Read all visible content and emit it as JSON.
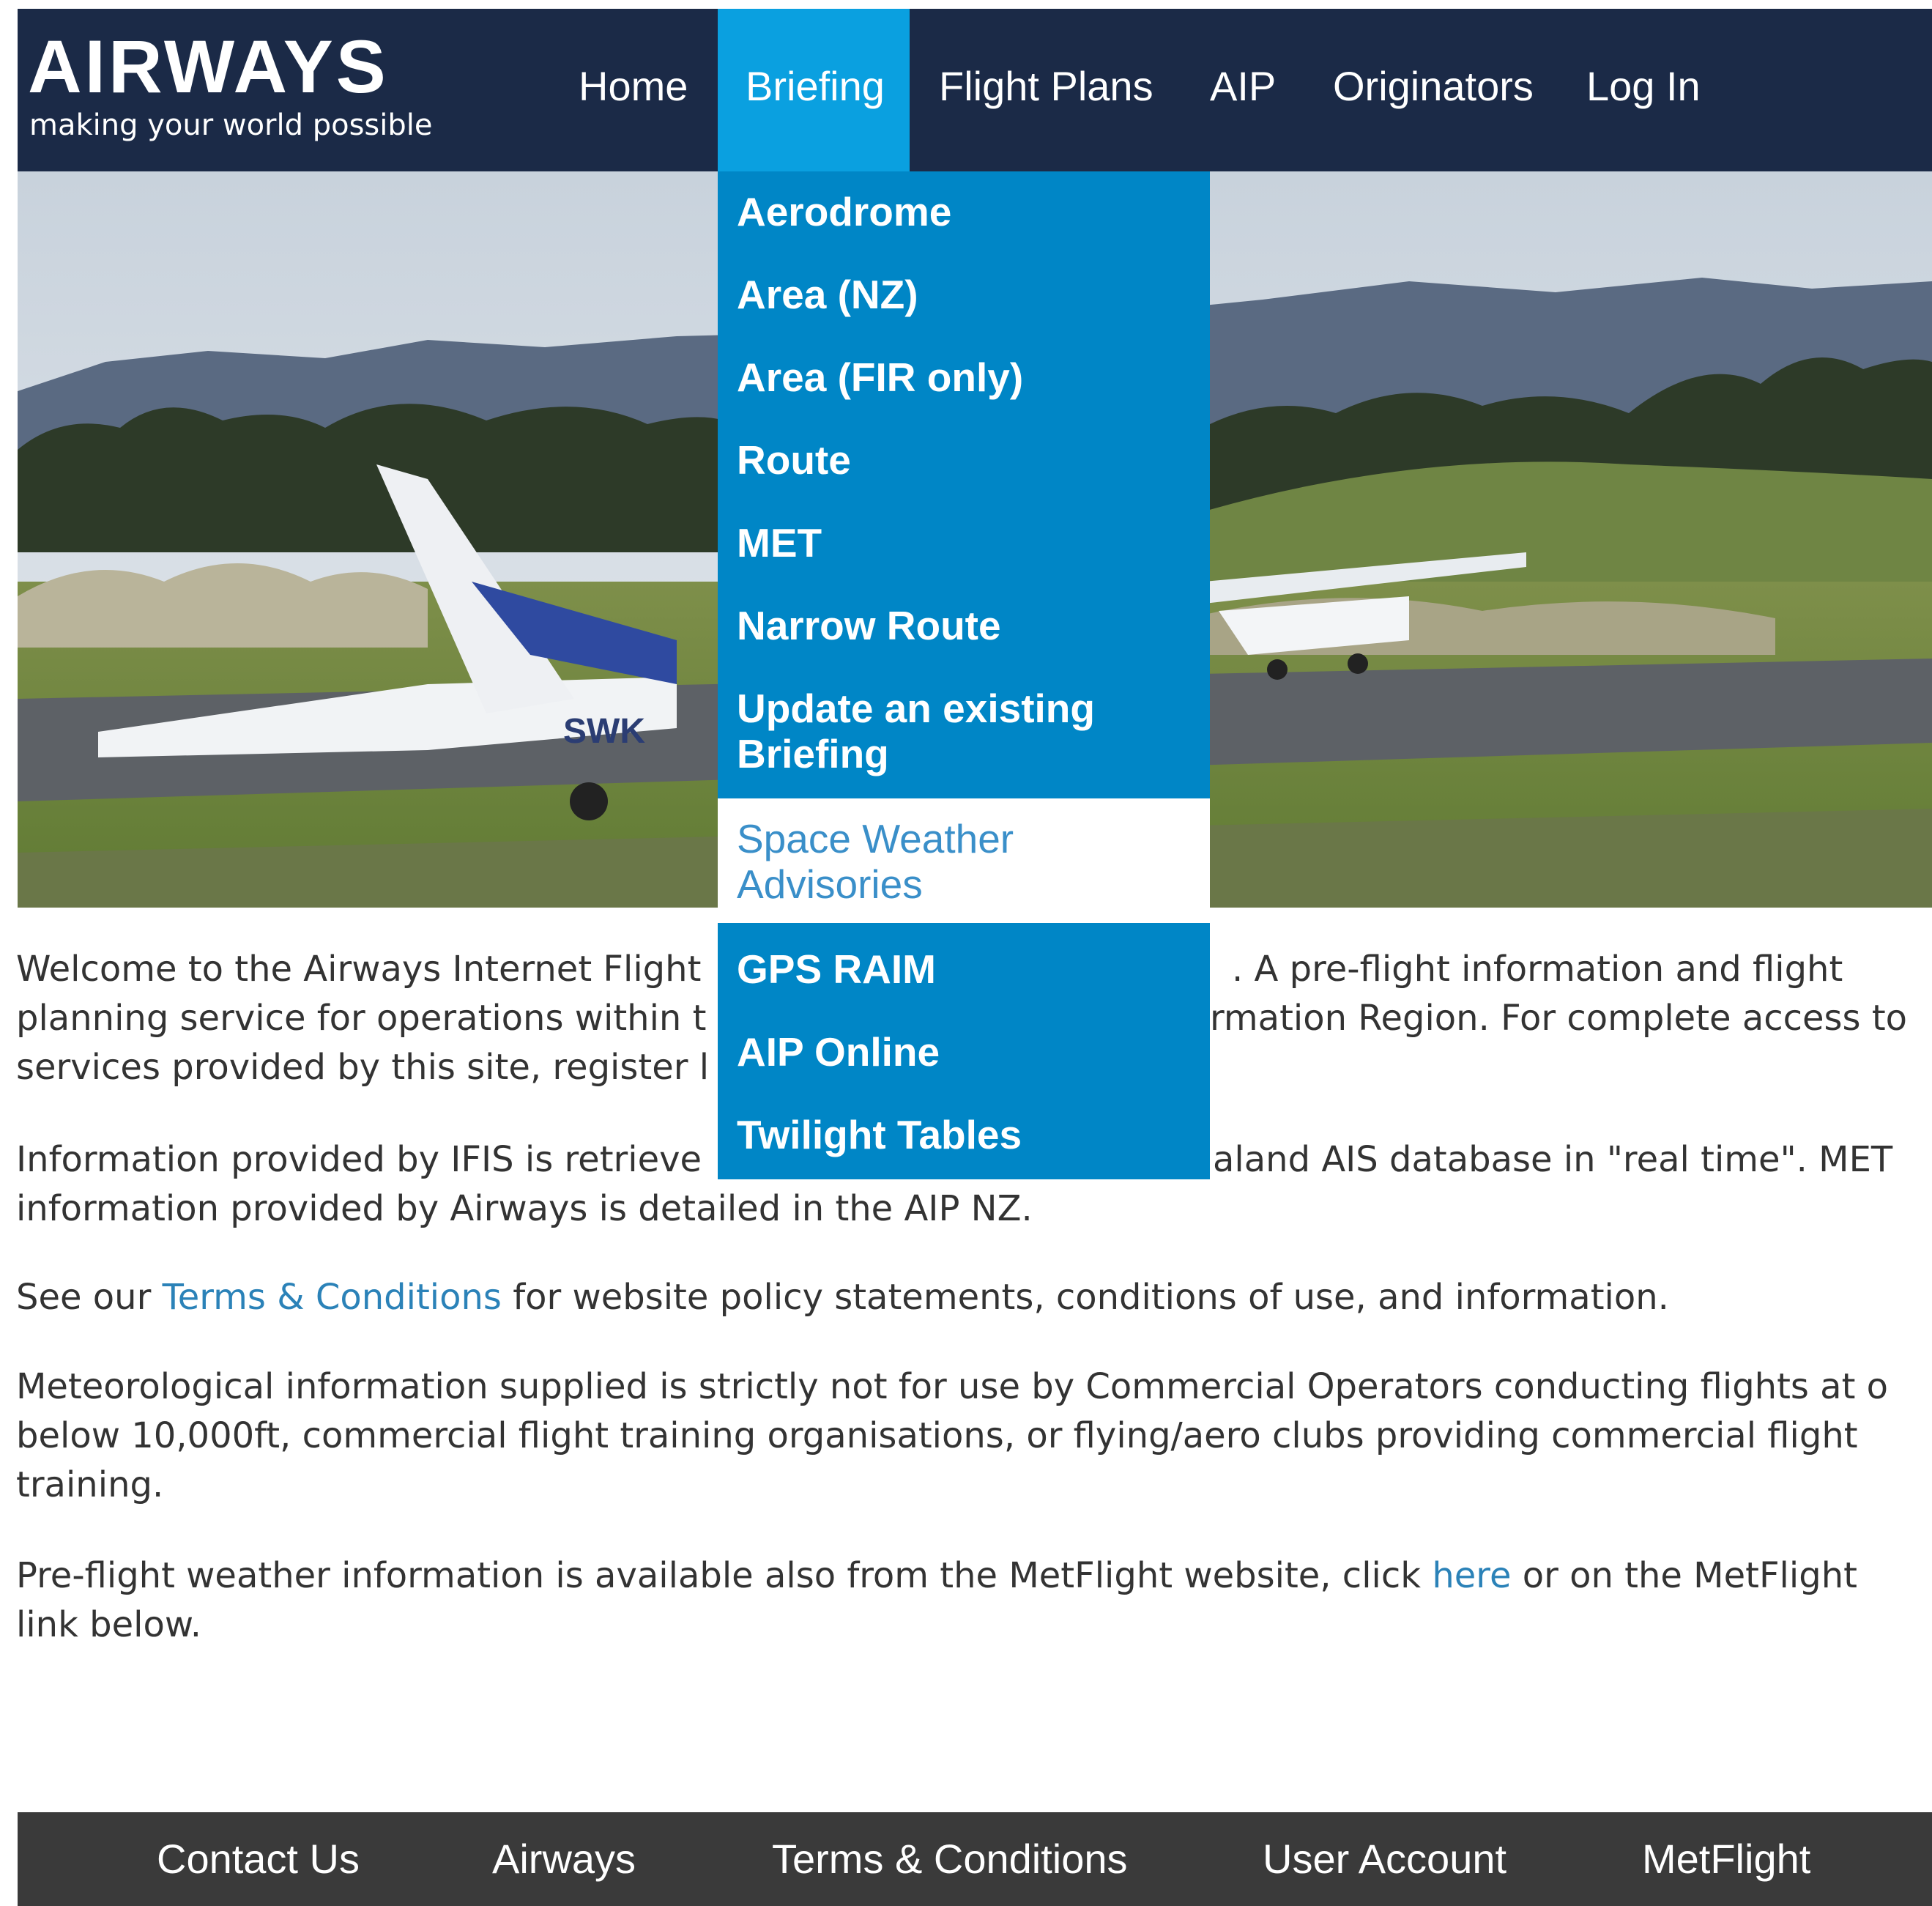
{
  "brand": {
    "wordmark": "AIRWAYS",
    "tagline": "making your world possible"
  },
  "nav": {
    "items": [
      {
        "label": "Home"
      },
      {
        "label": "Briefing",
        "active": true
      },
      {
        "label": "Flight Plans"
      },
      {
        "label": "AIP"
      },
      {
        "label": "Originators"
      },
      {
        "label": "Log In"
      }
    ]
  },
  "hero": {
    "aircraft_registration": "SWK"
  },
  "dropdown": {
    "items": [
      {
        "line1": "Aerodrome"
      },
      {
        "line1": "Area (NZ)"
      },
      {
        "line1": "Area (FIR only)"
      },
      {
        "line1": "Route"
      },
      {
        "line1": "MET"
      },
      {
        "line1": "Narrow Route"
      },
      {
        "line1": "Update an existing",
        "line2": "Briefing"
      },
      {
        "line1": "Space Weather",
        "line2": "Advisories",
        "hovered": true
      },
      {
        "line1": "GPS RAIM"
      },
      {
        "line1": "AIP Online"
      },
      {
        "line1": "Twilight Tables"
      }
    ]
  },
  "content": {
    "p1": {
      "l1a": "Welcome to the Airways Internet Flight",
      "l1b": ". A pre-flight information and flight",
      "l2a": "planning service for operations within t",
      "l2b": "rmation Region. For complete access to",
      "l3a": "services provided by this site, register l"
    },
    "p2": {
      "l1a": "Information provided by IFIS is retrieve",
      "l1b": "aland AIS database in \"real time\". MET",
      "l2": "information provided by Airways is detailed in the AIP NZ."
    },
    "p3": {
      "pre": "See our ",
      "link": "Terms & Conditions",
      "post": " for website policy statements, conditions of use, and information."
    },
    "p4": {
      "l1": "Meteorological information supplied is strictly not for use by Commercial Operators conducting flights at o",
      "l2": "below 10,000ft, commercial flight training organisations, or flying/aero clubs providing commercial flight",
      "l3": "training."
    },
    "p5": {
      "pre": "Pre-flight weather information is available also from the MetFlight website, click ",
      "link": "here",
      "post": " or on the MetFlight",
      "l2": "link below."
    }
  },
  "footer": {
    "items": [
      {
        "label": "Contact Us"
      },
      {
        "label": "Airways"
      },
      {
        "label": "Terms & Conditions"
      },
      {
        "label": "User Account"
      },
      {
        "label": "MetFlight"
      }
    ]
  },
  "colors": {
    "header_bg": "#1b2a47",
    "nav_active": "#0aa0e0",
    "dropdown_bg": "#0086c6",
    "link": "#2b82b8",
    "footer_bg": "#3a3a3a"
  }
}
